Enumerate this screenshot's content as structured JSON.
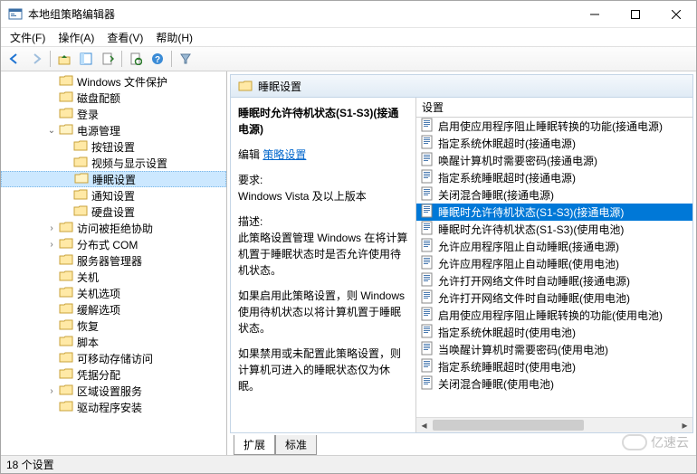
{
  "window": {
    "title": "本地组策略编辑器"
  },
  "menus": {
    "file": "文件(F)",
    "action": "操作(A)",
    "view": "查看(V)",
    "help": "帮助(H)"
  },
  "tree": {
    "items": [
      {
        "indent": 3,
        "label": "Windows 文件保护",
        "expandable": false
      },
      {
        "indent": 3,
        "label": "磁盘配额",
        "expandable": false
      },
      {
        "indent": 3,
        "label": "登录",
        "expandable": false
      },
      {
        "indent": 3,
        "label": "电源管理",
        "expandable": true,
        "expanded": true
      },
      {
        "indent": 4,
        "label": "按钮设置",
        "expandable": false
      },
      {
        "indent": 4,
        "label": "视频与显示设置",
        "expandable": false
      },
      {
        "indent": 4,
        "label": "睡眠设置",
        "expandable": false,
        "selected": true
      },
      {
        "indent": 4,
        "label": "通知设置",
        "expandable": false
      },
      {
        "indent": 4,
        "label": "硬盘设置",
        "expandable": false
      },
      {
        "indent": 3,
        "label": "访问被拒绝协助",
        "expandable": true,
        "expanded": false
      },
      {
        "indent": 3,
        "label": "分布式 COM",
        "expandable": true,
        "expanded": false
      },
      {
        "indent": 3,
        "label": "服务器管理器",
        "expandable": false
      },
      {
        "indent": 3,
        "label": "关机",
        "expandable": false
      },
      {
        "indent": 3,
        "label": "关机选项",
        "expandable": false
      },
      {
        "indent": 3,
        "label": "缓解选项",
        "expandable": false
      },
      {
        "indent": 3,
        "label": "恢复",
        "expandable": false
      },
      {
        "indent": 3,
        "label": "脚本",
        "expandable": false
      },
      {
        "indent": 3,
        "label": "可移动存储访问",
        "expandable": false
      },
      {
        "indent": 3,
        "label": "凭据分配",
        "expandable": false
      },
      {
        "indent": 3,
        "label": "区域设置服务",
        "expandable": true,
        "expanded": false
      },
      {
        "indent": 3,
        "label": "驱动程序安装",
        "expandable": false
      }
    ]
  },
  "content": {
    "header": "睡眠设置",
    "selected_setting_title": "睡眠时允许待机状态(S1-S3)(接通电源)",
    "edit_label": "编辑",
    "edit_link": "策略设置",
    "req_label": "要求:",
    "req_value": "Windows Vista 及以上版本",
    "desc_label": "描述:",
    "desc_p1": "此策略设置管理 Windows 在将计算机置于睡眠状态时是否允许使用待机状态。",
    "desc_p2": "如果启用此策略设置，则 Windows 使用待机状态以将计算机置于睡眠状态。",
    "desc_p3": "如果禁用或未配置此策略设置，则计算机可进入的睡眠状态仅为休眠。"
  },
  "list": {
    "column_header": "设置",
    "items": [
      {
        "label": "启用使应用程序阻止睡眠转换的功能(接通电源)"
      },
      {
        "label": "指定系统休眠超时(接通电源)"
      },
      {
        "label": "唤醒计算机时需要密码(接通电源)"
      },
      {
        "label": "指定系统睡眠超时(接通电源)"
      },
      {
        "label": "关闭混合睡眠(接通电源)"
      },
      {
        "label": "睡眠时允许待机状态(S1-S3)(接通电源)",
        "selected": true
      },
      {
        "label": "睡眠时允许待机状态(S1-S3)(使用电池)"
      },
      {
        "label": "允许应用程序阻止自动睡眠(接通电源)"
      },
      {
        "label": "允许应用程序阻止自动睡眠(使用电池)"
      },
      {
        "label": "允许打开网络文件时自动睡眠(接通电源)"
      },
      {
        "label": "允许打开网络文件时自动睡眠(使用电池)"
      },
      {
        "label": "启用使应用程序阻止睡眠转换的功能(使用电池)"
      },
      {
        "label": "指定系统休眠超时(使用电池)"
      },
      {
        "label": "当唤醒计算机时需要密码(使用电池)"
      },
      {
        "label": "指定系统睡眠超时(使用电池)"
      },
      {
        "label": "关闭混合睡眠(使用电池)"
      }
    ]
  },
  "tabs": {
    "extended": "扩展",
    "standard": "标准"
  },
  "status": {
    "text": "18 个设置"
  },
  "watermark": "亿速云"
}
